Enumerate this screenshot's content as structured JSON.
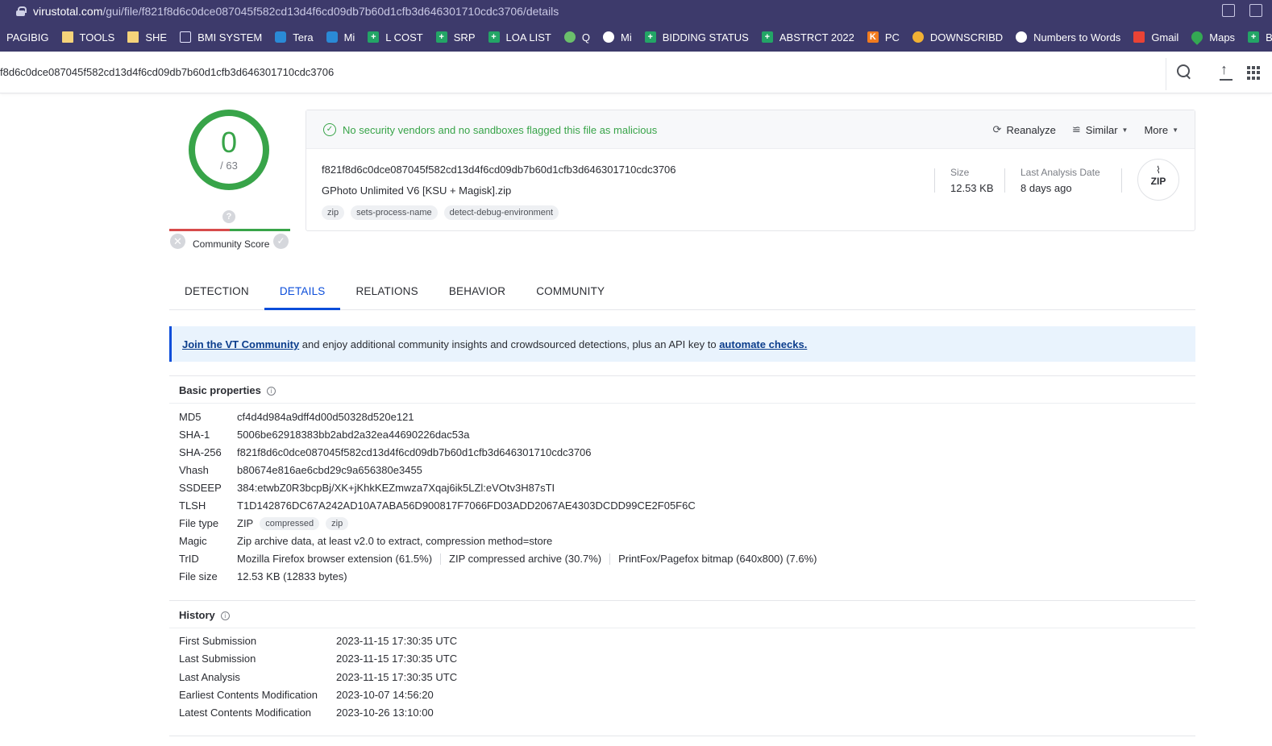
{
  "browser": {
    "url_domain": "virustotal.com",
    "url_path": "/gui/file/f821f8d6c0dce087045f582cd13d4f6cd09db7b60d1cfb3d646301710cdc3706/details"
  },
  "bookmarks": [
    {
      "label": "PAGIBIG",
      "icon": "none"
    },
    {
      "label": "TOOLS",
      "icon": "folder"
    },
    {
      "label": "SHE",
      "icon": "folder"
    },
    {
      "label": "BMI SYSTEM",
      "icon": "grid"
    },
    {
      "label": "Tera",
      "icon": "cloud"
    },
    {
      "label": "Mi",
      "icon": "cloud"
    },
    {
      "label": "L COST",
      "icon": "sheet"
    },
    {
      "label": "SRP",
      "icon": "sheet"
    },
    {
      "label": "LOA LIST",
      "icon": "sheet"
    },
    {
      "label": "Q",
      "icon": "gplus"
    },
    {
      "label": "Mi",
      "icon": "globe"
    },
    {
      "label": "BIDDING STATUS",
      "icon": "sheet"
    },
    {
      "label": "ABSTRCT 2022",
      "icon": "sheet"
    },
    {
      "label": "PC",
      "icon": "k"
    },
    {
      "label": "DOWNSCRIBD",
      "icon": "dl"
    },
    {
      "label": "Numbers to Words",
      "icon": "globe"
    },
    {
      "label": "Gmail",
      "icon": "gmail"
    },
    {
      "label": "Maps",
      "icon": "maps"
    },
    {
      "label": "BIDDING SUMMA",
      "icon": "sheet"
    }
  ],
  "search": {
    "query": "f8d6c0dce087045f582cd13d4f6cd09db7b60d1cfb3d646301710cdc3706"
  },
  "score": {
    "detections": "0",
    "total": "/ 63",
    "community_label": "Community Score",
    "question_mark": "?"
  },
  "summary": {
    "status_text": "No security vendors and no sandboxes flagged this file as malicious",
    "actions": {
      "reanalyze": "Reanalyze",
      "similar": "Similar",
      "more": "More"
    },
    "hash": "f821f8d6c0dce087045f582cd13d4f6cd09db7b60d1cfb3d646301710cdc3706",
    "filename": "GPhoto Unlimited V6 [KSU + Magisk].zip",
    "tags": [
      "zip",
      "sets-process-name",
      "detect-debug-environment"
    ],
    "size_label": "Size",
    "size_value": "12.53 KB",
    "last_analysis_label": "Last Analysis Date",
    "last_analysis_value": "8 days ago",
    "type_badge": "ZIP"
  },
  "tabs": [
    "DETECTION",
    "DETAILS",
    "RELATIONS",
    "BEHAVIOR",
    "COMMUNITY"
  ],
  "active_tab": "DETAILS",
  "banner": {
    "link1": "Join the VT Community",
    "middle": " and enjoy additional community insights and crowdsourced detections, plus an API key to ",
    "link2": "automate checks."
  },
  "basic_properties": {
    "title": "Basic properties",
    "md5_k": "MD5",
    "md5_v": "cf4d4d984a9dff4d00d50328d520e121",
    "sha1_k": "SHA-1",
    "sha1_v": "5006be62918383bb2abd2a32ea44690226dac53a",
    "sha256_k": "SHA-256",
    "sha256_v": "f821f8d6c0dce087045f582cd13d4f6cd09db7b60d1cfb3d646301710cdc3706",
    "vhash_k": "Vhash",
    "vhash_v": "b80674e816ae6cbd29c9a656380e3455",
    "ssdeep_k": "SSDEEP",
    "ssdeep_v": "384:etwbZ0R3bcpBj/XK+jKhkKEZmwza7Xqaj6ik5LZl:eVOtv3H87sTI",
    "tlsh_k": "TLSH",
    "tlsh_v": "T1D142876DC67A242AD10A7ABA56D900817F7066FD03ADD2067AE4303DCDD99CE2F05F6C",
    "filetype_k": "File type",
    "filetype_v": "ZIP",
    "filetype_tag1": "compressed",
    "filetype_tag2": "zip",
    "magic_k": "Magic",
    "magic_v": "Zip archive data, at least v2.0 to extract, compression method=store",
    "trid_k": "TrID",
    "trid_v1": "Mozilla Firefox browser extension (61.5%)",
    "trid_v2": "ZIP compressed archive (30.7%)",
    "trid_v3": "PrintFox/Pagefox bitmap (640x800) (7.6%)",
    "filesize_k": "File size",
    "filesize_v": "12.53 KB (12833 bytes)"
  },
  "history": {
    "title": "History",
    "first_k": "First Submission",
    "first_v": "2023-11-15 17:30:35 UTC",
    "last_k": "Last Submission",
    "last_v": "2023-11-15 17:30:35 UTC",
    "analysis_k": "Last Analysis",
    "analysis_v": "2023-11-15 17:30:35 UTC",
    "earliest_k": "Earliest Contents Modification",
    "earliest_v": "2023-10-07 14:56:20",
    "latest_k": "Latest Contents Modification",
    "latest_v": "2023-10-26 13:10:00"
  },
  "colors": {
    "clean_green": "#38a449",
    "accent_blue": "#0b4dda",
    "chrome_purple": "#3d3a6b"
  }
}
